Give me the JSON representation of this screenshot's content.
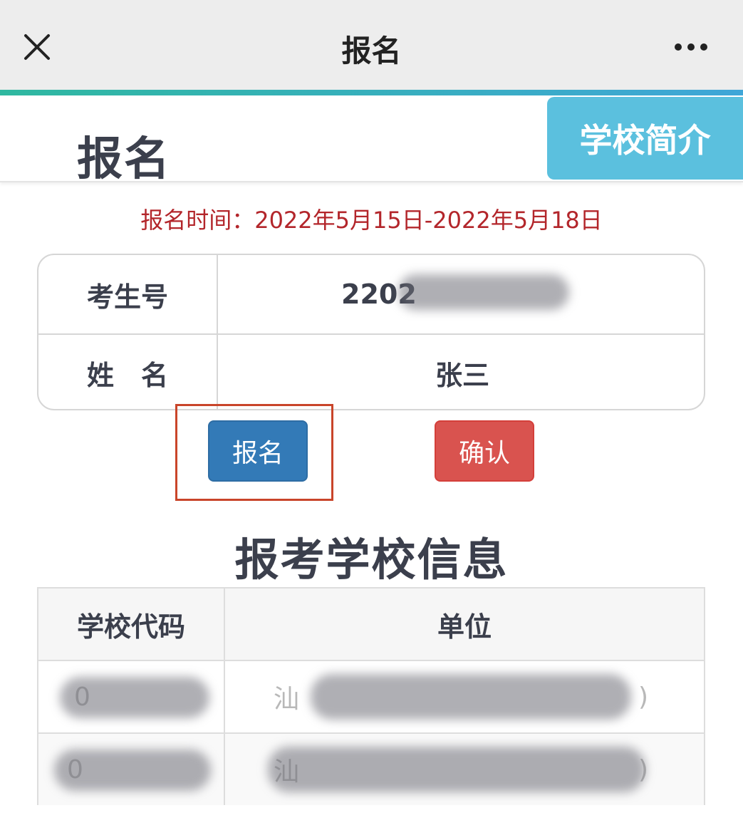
{
  "navbar": {
    "title": "报名"
  },
  "header": {
    "page_title": "报名",
    "intro_tab": "学校简介"
  },
  "registration_time": "报名时间：2022年5月15日-2022年5月18日",
  "candidate": {
    "id_label": "考生号",
    "id_value_visible": "2202",
    "name_label": "姓　名",
    "name_value": "张三"
  },
  "buttons": {
    "register": "报名",
    "confirm": "确认"
  },
  "school_section": {
    "title": "报考学校信息",
    "columns": [
      "学校代码",
      "单位"
    ],
    "rows": [
      {
        "code": "0",
        "unit_prefix": "汕",
        "unit_suffix": ")"
      },
      {
        "code": "0",
        "unit_prefix": "汕",
        "unit_suffix": ")"
      }
    ]
  },
  "colors": {
    "accent_blue": "#337ab7",
    "accent_red": "#d9534f",
    "intro_tab": "#5bc0de",
    "time_text": "#b3262b",
    "highlight_box": "#c9452a"
  }
}
